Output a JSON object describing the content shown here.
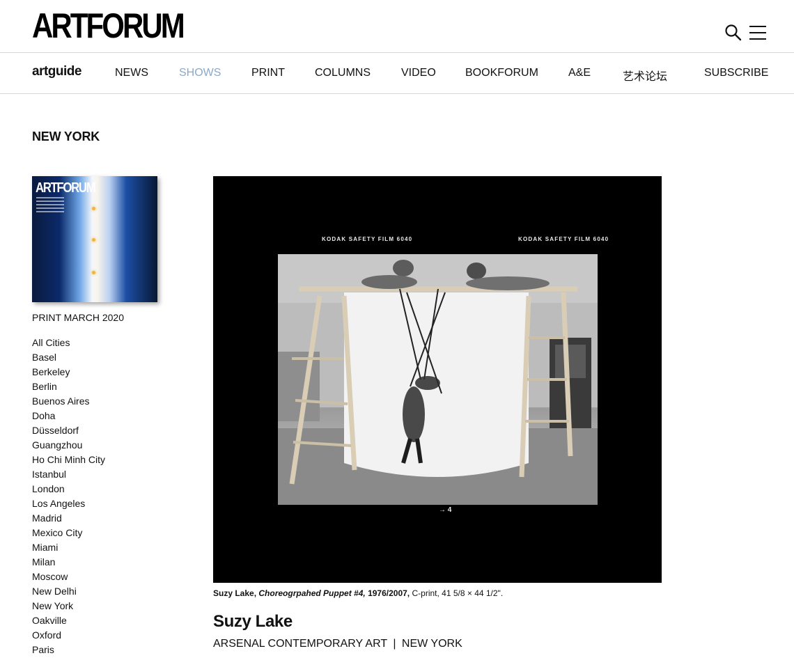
{
  "header": {
    "logo": "ARTFORUM",
    "search_icon": "search-icon",
    "menu_icon": "hamburger-menu-icon"
  },
  "nav": {
    "brand": "artguide",
    "items": [
      {
        "label": "NEWS",
        "active": false
      },
      {
        "label": "SHOWS",
        "active": true
      },
      {
        "label": "PRINT",
        "active": false
      },
      {
        "label": "COLUMNS",
        "active": false
      },
      {
        "label": "VIDEO",
        "active": false
      },
      {
        "label": "BOOKFORUM",
        "active": false
      },
      {
        "label": "A&E",
        "active": false
      },
      {
        "label": "艺术论坛",
        "active": false
      },
      {
        "label": "SUBSCRIBE",
        "active": false
      }
    ],
    "active_color": "#8aa9c7"
  },
  "section": {
    "city": "NEW YORK"
  },
  "sidebar": {
    "cover_title": "ARTFORUM",
    "print_label": "PRINT MARCH 2020",
    "cities": [
      "All Cities",
      "Basel",
      "Berkeley",
      "Berlin",
      "Buenos Aires",
      "Doha",
      "Düsseldorf",
      "Guangzhou",
      "Ho Chi Minh City",
      "Istanbul",
      "London",
      "Los Angeles",
      "Madrid",
      "Mexico City",
      "Miami",
      "Milan",
      "Moscow",
      "New Delhi",
      "New York",
      "Oakville",
      "Oxford",
      "Paris"
    ]
  },
  "artwork": {
    "film_edge_left": "KODAK SAFETY FILM 6040",
    "film_edge_right": "KODAK SAFETY FILM 6040",
    "frame_number": "→ 4",
    "caption": {
      "artist": "Suzy Lake,",
      "title": "Choreogrpahed Puppet #4,",
      "year": "1976/2007,",
      "details": "C-print, 41 5/8 × 44 1/2\"."
    }
  },
  "review": {
    "artist": "Suzy Lake",
    "venue": "ARSENAL CONTEMPORARY ART",
    "separator": "|",
    "city": "NEW YORK"
  }
}
